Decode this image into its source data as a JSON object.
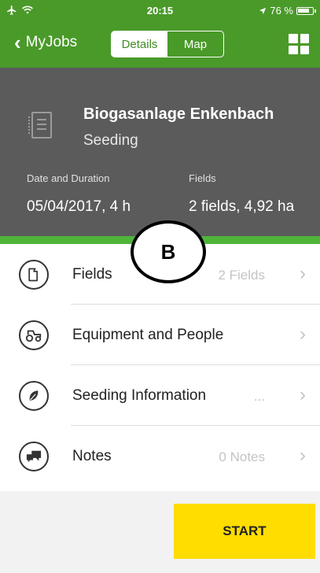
{
  "status_bar": {
    "time": "20:15",
    "battery": "76 %"
  },
  "nav": {
    "back_label": "MyJobs",
    "tabs": [
      {
        "label": "Details",
        "active": true
      },
      {
        "label": "Map",
        "active": false
      }
    ]
  },
  "job": {
    "title": "Biogasanlage Enkenbach",
    "subtitle": "Seeding",
    "date_label": "Date and Duration",
    "date_value": "05/04/2017, 4 h",
    "fields_label": "Fields",
    "fields_value": "2 fields, 4,92 ha"
  },
  "list": [
    {
      "label": "Fields",
      "value": "2 Fields",
      "icon": "field-icon"
    },
    {
      "label": "Equipment and People",
      "value": "",
      "icon": "tractor-icon"
    },
    {
      "label": "Seeding Information",
      "value": "...",
      "icon": "leaf-icon"
    },
    {
      "label": "Notes",
      "value": "0 Notes",
      "icon": "notes-icon"
    }
  ],
  "start_label": "START",
  "marker_label": "B",
  "colors": {
    "green": "#4a9a2a",
    "header_gray": "#5b5b5b",
    "start_yellow": "#ffdd00"
  }
}
